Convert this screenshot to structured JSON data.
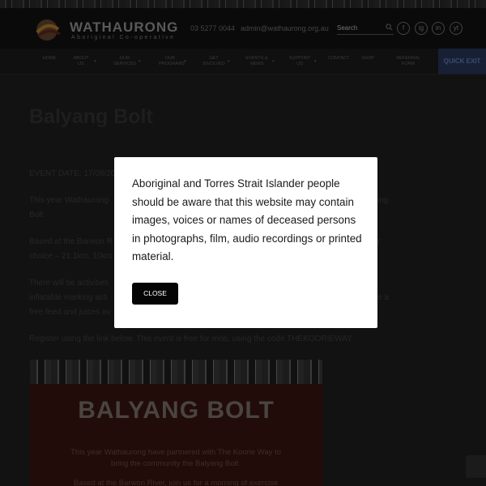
{
  "header": {
    "brand": "WATHAURONG",
    "brand_sub": "Aboriginal Co-operative",
    "phone": "03 5277 0044",
    "email": "admin@wathaurong.org.au",
    "search_placeholder": "Search",
    "social": [
      "f",
      "ig",
      "in",
      "yt"
    ]
  },
  "nav": {
    "items": [
      "HOME",
      "ABOUT US",
      "OUR SERVICES",
      "OUR PROGRAMS",
      "GET INVOLVED",
      "EVENTS & NEWS",
      "SUPPORT US",
      "CONTACT",
      "SHOP",
      "REFERRAL FORM"
    ],
    "quick_exit": "QUICK EXIT"
  },
  "content": {
    "title": "Balyang Bolt",
    "event_date": "EVENT DATE: 17/08/20",
    "p1_start": "This year Wathaurong",
    "p1_end": "ing",
    "p1_line2": "Bolt.",
    "p2_start": "Based at the Barwon R",
    "p2_end": "r",
    "p2_line2": "choice – 21.1km, 10km",
    "p3_start": "There will be activities",
    "p3_line2_start": "inflatable marking acti",
    "p3_line2_end": "e a",
    "p3_line3": "free feed and juices av",
    "register": "Register using the link below. This event is free for mob, using the code THEKOORIEWAY."
  },
  "poster": {
    "title": "BALYANG BOLT",
    "text_line1": "This year Wathaurong have partnered with The Koorie Way to",
    "text_line2": "bring the community the Balyang Bolt.",
    "text_line3": "Based at the Barwon River, join us for a morning of exercise"
  },
  "modal": {
    "message": "Aboriginal and Torres Strait Islander people should be aware that this website may contain images, voices or names of deceased persons in photographs, film, audio recordings or printed material.",
    "close_label": "CLOSE"
  }
}
